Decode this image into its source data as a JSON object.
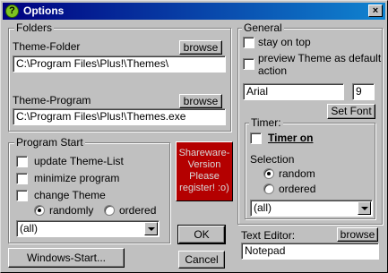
{
  "window": {
    "title": "Options",
    "close_glyph": "×",
    "app_icon": "?"
  },
  "folders": {
    "legend": "Folders",
    "theme_folder": {
      "label": "Theme-Folder",
      "browse": "browse",
      "value": "C:\\Program Files\\Plus!\\Themes\\"
    },
    "theme_program": {
      "label": "Theme-Program",
      "browse": "browse",
      "value": "C:\\Program Files\\Plus!\\Themes.exe"
    }
  },
  "program_start": {
    "legend": "Program Start",
    "update_theme_list": "update Theme-List",
    "minimize_program": "minimize program",
    "change_theme": "change Theme",
    "randomly": "randomly",
    "ordered": "ordered",
    "dropdown_value": "(all)"
  },
  "general": {
    "legend": "General",
    "stay_on_top": "stay on top",
    "preview_line1": "preview Theme as default",
    "preview_line2": "action",
    "font_name": "Arial",
    "font_size": "9",
    "set_font": "Set Font"
  },
  "timer": {
    "legend": "Timer:",
    "timer_on": "Timer on",
    "selection": "Selection",
    "random": "random",
    "ordered": "ordered",
    "dropdown_value": "(all)"
  },
  "text_editor": {
    "label": "Text Editor:",
    "browse": "browse",
    "value": "Notepad"
  },
  "shareware": {
    "lines": [
      "Shareware-",
      "Version",
      "Please",
      "register! :o)"
    ]
  },
  "buttons": {
    "ok": "OK",
    "cancel": "Cancel",
    "windows_start": "Windows-Start..."
  }
}
